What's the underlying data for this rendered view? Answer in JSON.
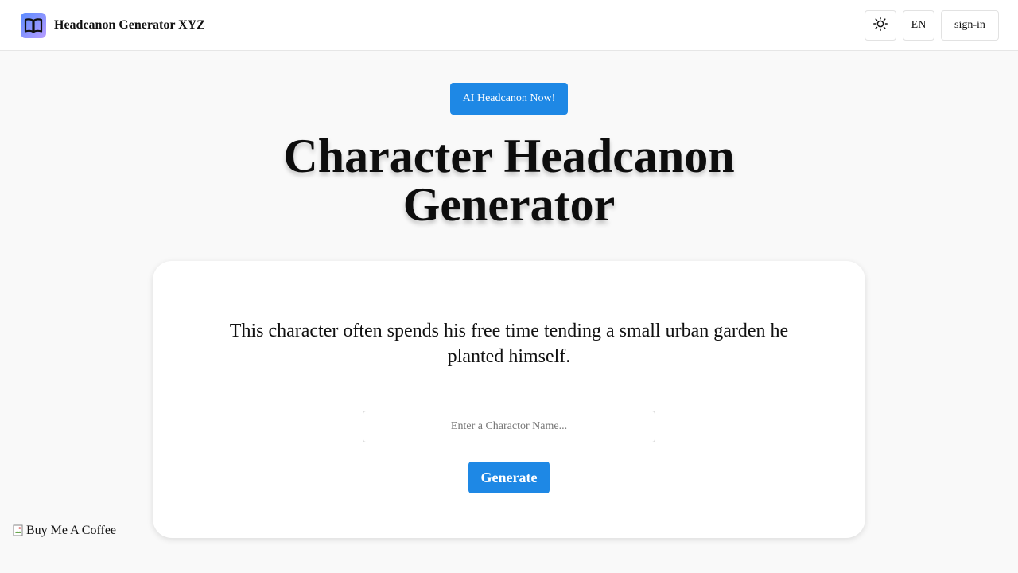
{
  "header": {
    "brand_name": "Headcanon Generator XYZ",
    "logo_icon": "open-book-icon",
    "theme_icon": "sun-icon",
    "language_label": "EN",
    "signin_label": "sign-in"
  },
  "hero": {
    "badge_label": "AI Headcanon Now!",
    "title": "Character Headcanon Generator"
  },
  "generator": {
    "result_text": "This character often spends his free time tending a small urban garden he planted himself.",
    "input_value": "",
    "input_placeholder": "Enter a Charactor Name...",
    "generate_label": "Generate"
  },
  "footer": {
    "coffee_alt_text": "Buy Me A Coffee",
    "coffee_icon": "broken-image-icon"
  },
  "colors": {
    "accent": "#1e88e5",
    "background": "#f9f9f9",
    "card": "#ffffff",
    "logo_gradient_start": "#5b8cff",
    "logo_gradient_end": "#b79cff"
  }
}
